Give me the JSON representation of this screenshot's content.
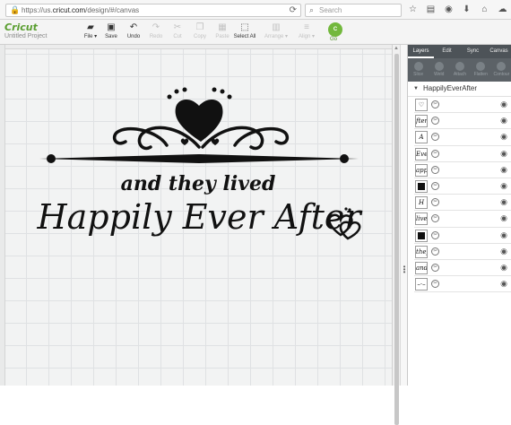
{
  "browser": {
    "url_prefix": "https://us.",
    "url_domain": "cricut.com",
    "url_suffix": "/design/#/canvas",
    "search_placeholder": "Search",
    "icons": [
      "star-icon",
      "clipboard-icon",
      "pocket-icon",
      "download-icon",
      "home-icon",
      "chat-icon",
      "menu-icon"
    ]
  },
  "app": {
    "logo": "Cricut",
    "project_name": "Untitled Project",
    "toolbar": [
      {
        "label": "File ▾",
        "icon": "folder-icon",
        "enabled": true
      },
      {
        "label": "Save",
        "icon": "save-icon",
        "enabled": true
      },
      {
        "label": "Undo",
        "icon": "undo-icon",
        "enabled": true
      },
      {
        "label": "Redo",
        "icon": "redo-icon",
        "enabled": false
      },
      {
        "label": "Cut",
        "icon": "cut-icon",
        "enabled": false
      },
      {
        "label": "Copy",
        "icon": "copy-icon",
        "enabled": false
      },
      {
        "label": "Paste",
        "icon": "paste-icon",
        "enabled": false
      },
      {
        "label": "Select All",
        "icon": "select-all-icon",
        "enabled": true
      },
      {
        "label": "Arrange ▾",
        "icon": "arrange-icon",
        "enabled": false
      },
      {
        "label": "Align ▾",
        "icon": "align-icon",
        "enabled": false
      }
    ],
    "go_button": {
      "label": "Go",
      "icon_text": "C"
    }
  },
  "canvas": {
    "line1": "and they lived",
    "line2": "Happily Ever After"
  },
  "panel": {
    "tabs": [
      "Layers",
      "Edit",
      "Sync",
      "Canvas"
    ],
    "active_tab": "Layers",
    "tools": [
      "Slice",
      "Weld",
      "Attach",
      "Flatten",
      "Contour"
    ],
    "group_name": "HappilyEverAfter",
    "layers": [
      {
        "thumb": "♡",
        "solid": false
      },
      {
        "thumb": "fter",
        "solid": false
      },
      {
        "thumb": "A",
        "solid": false
      },
      {
        "thumb": "Ever",
        "solid": false
      },
      {
        "thumb": "appily",
        "solid": false
      },
      {
        "thumb": "",
        "solid": true
      },
      {
        "thumb": "H",
        "solid": false
      },
      {
        "thumb": "lived",
        "solid": false
      },
      {
        "thumb": "",
        "solid": true
      },
      {
        "thumb": "they",
        "solid": false
      },
      {
        "thumb": "and",
        "solid": false
      },
      {
        "thumb": "–·–",
        "solid": false
      }
    ]
  },
  "colors": {
    "brand_green": "#5a9e30",
    "go_green": "#72b83c",
    "panel_dark": "#4d5358"
  }
}
